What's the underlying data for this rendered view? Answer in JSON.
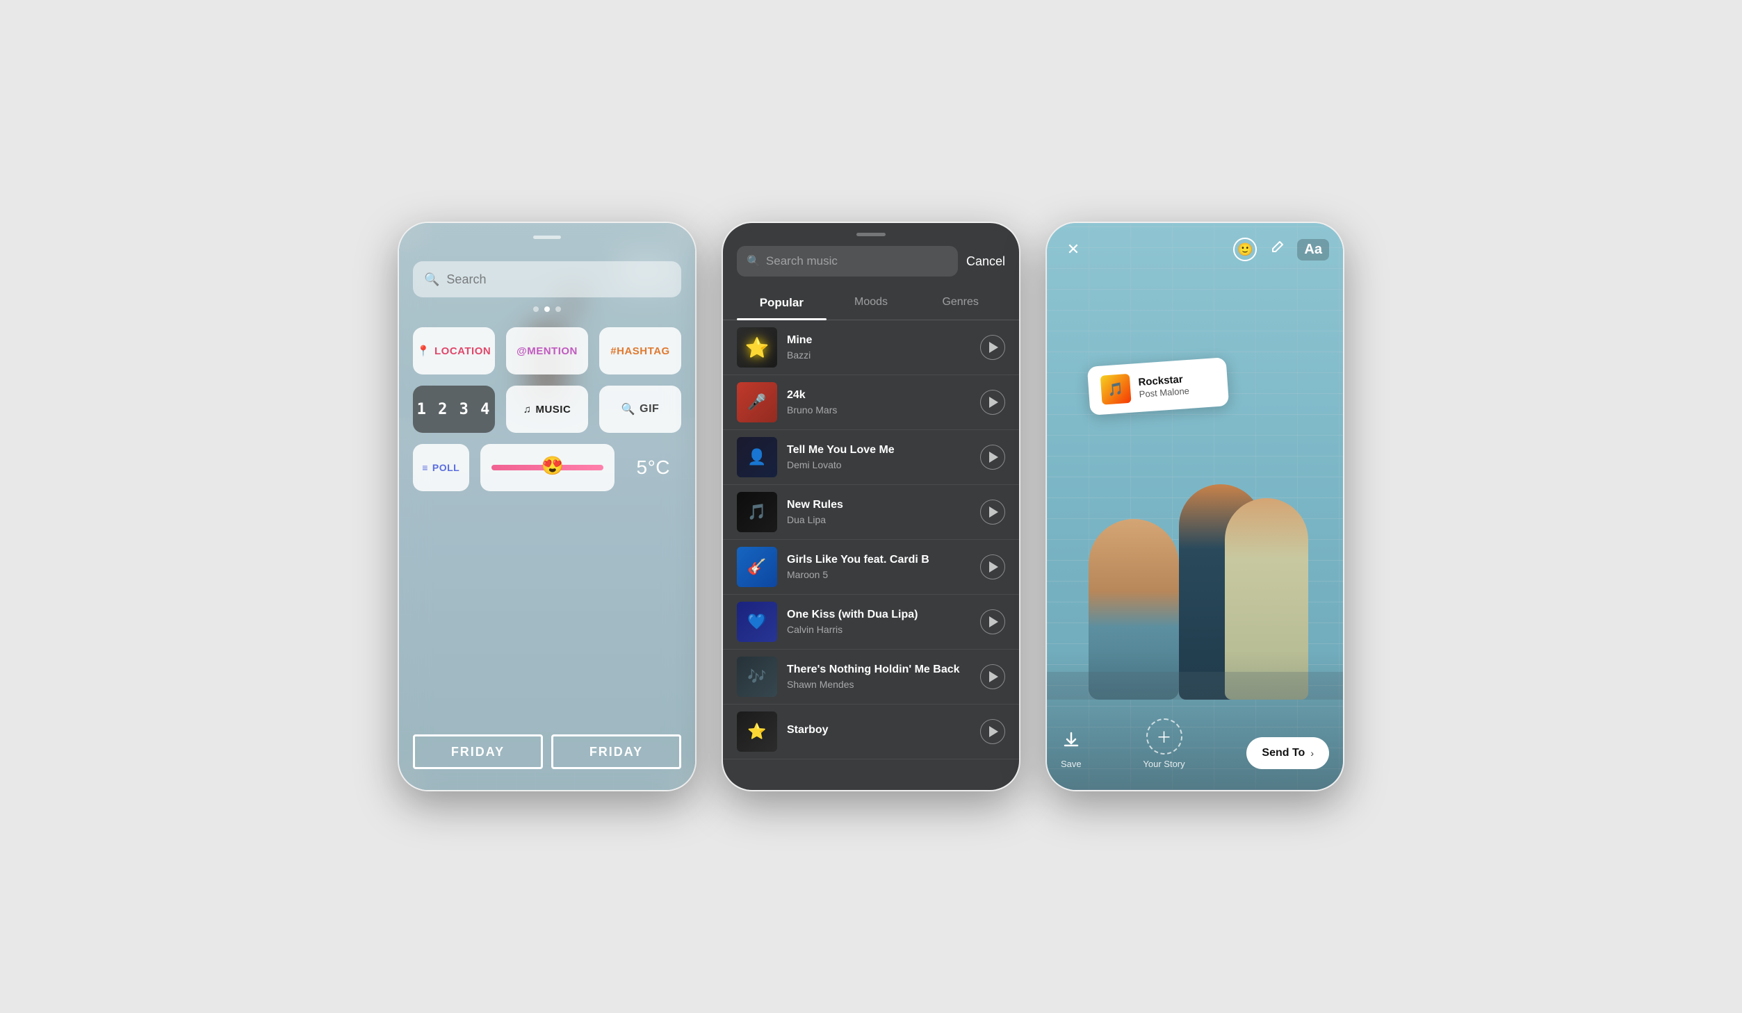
{
  "phone1": {
    "search_placeholder": "Search",
    "stickers": {
      "location": "📍 LOCATION",
      "mention": "@MENTION",
      "hashtag": "#HASHTAG",
      "countdown": "1 2  3 4",
      "music": "♫ MUSIC",
      "gif": "🔍 GIF",
      "poll": "≡ POLL",
      "temperature": "5°C",
      "friday1": "FRIDAY",
      "friday2": "FRIDAY"
    }
  },
  "phone2": {
    "search_placeholder": "Search music",
    "cancel_label": "Cancel",
    "tabs": [
      "Popular",
      "Moods",
      "Genres"
    ],
    "active_tab": "Popular",
    "songs": [
      {
        "title": "Mine",
        "artist": "Bazzi",
        "art_class": "album-art-mine"
      },
      {
        "title": "24k",
        "artist": "Bruno Mars",
        "art_class": "album-art-24k"
      },
      {
        "title": "Tell Me You Love Me",
        "artist": "Demi Lovato",
        "art_class": "album-art-tellme"
      },
      {
        "title": "New Rules",
        "artist": "Dua Lipa",
        "art_class": "album-art-newrules"
      },
      {
        "title": "Girls Like You feat. Cardi B",
        "artist": "Maroon 5",
        "art_class": "album-art-girls"
      },
      {
        "title": "One Kiss (with Dua Lipa)",
        "artist": "Calvin Harris",
        "art_class": "album-art-onekiss"
      },
      {
        "title": "There's Nothing Holdin' Me Back",
        "artist": "Shawn Mendes",
        "art_class": "album-art-holdin"
      },
      {
        "title": "Starboy",
        "artist": "",
        "art_class": "album-art-starboy"
      }
    ]
  },
  "phone3": {
    "sticker_song": "Rockstar",
    "sticker_artist": "Post Malone",
    "save_label": "Save",
    "your_story_label": "Your Story",
    "send_to_label": "Send To"
  }
}
